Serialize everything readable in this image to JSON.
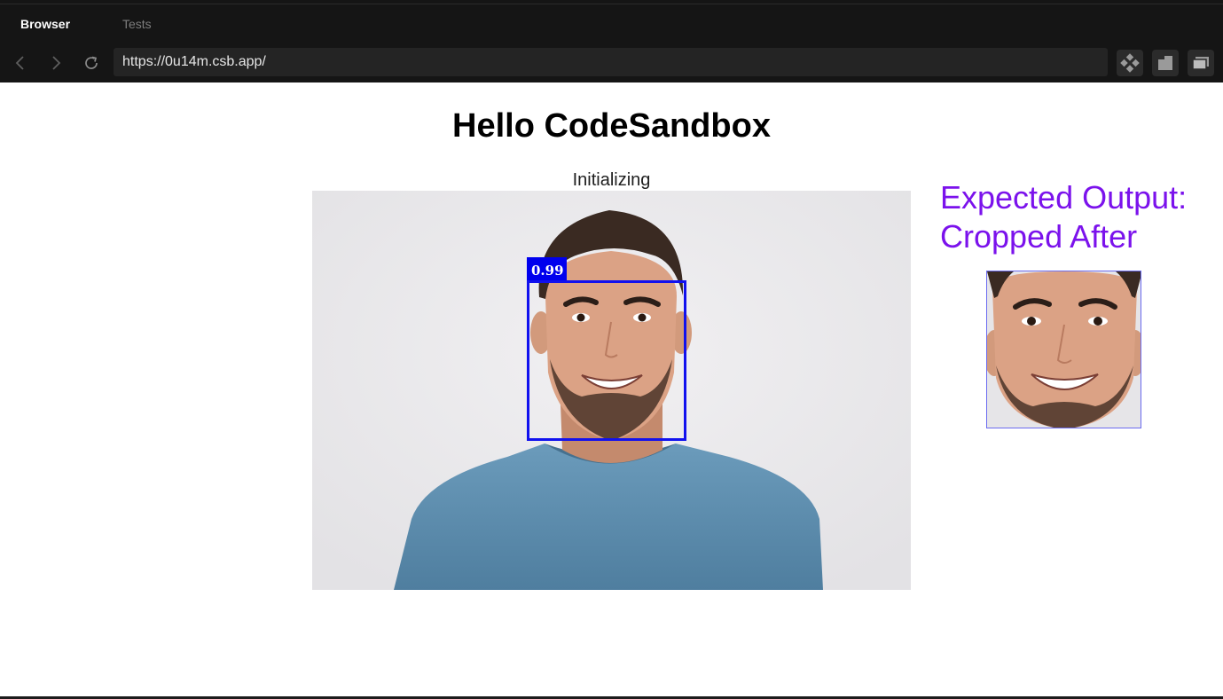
{
  "browser": {
    "tabs": [
      {
        "label": "Browser",
        "active": true
      },
      {
        "label": "Tests",
        "active": false
      }
    ],
    "url": "https://0u14m.csb.app/",
    "icons": [
      "back-arrow-icon",
      "forward-arrow-icon",
      "reload-icon",
      "codesandbox-icon",
      "split-view-icon",
      "new-window-icon"
    ]
  },
  "page": {
    "title": "Hello CodeSandbox",
    "status": "Initializing",
    "detection": {
      "score_label": "0.99",
      "box_color": "#1111ee"
    },
    "expected_heading": "Expected Output: Cropped After",
    "heading_color": "#7b12ec"
  }
}
